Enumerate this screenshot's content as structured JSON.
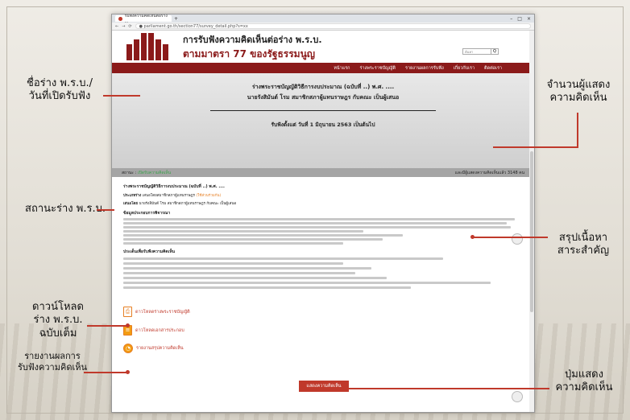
{
  "browser": {
    "tab_title": "รับฟังความคิดเห็นต่อร่าง ...",
    "url": "● parliament.go.th/section77/survey_detail.php?s=xx",
    "new_tab": "+",
    "win_controls": [
      "–",
      "□",
      "×"
    ]
  },
  "site": {
    "title_line1": "การรับฟังความคิดเห็นต่อร่าง พ.ร.บ.",
    "title_line2": "ตามมาตรา 77 ของรัฐธรรมนูญ",
    "search_placeholder": "ค้นหา",
    "search_button": "Q"
  },
  "nav": [
    "หน้าแรก",
    "ร่างพระราชบัญญัติ",
    "รายงานผลการรับฟัง",
    "เกี่ยวกับเรา",
    "ติดต่อเรา"
  ],
  "hero": {
    "line1": "ร่างพระราชบัญญัติวิธีการงบประมาณ (ฉบับที่ ..) พ.ศ. ....",
    "line2": "นายรังสิมันต์ โรม สมาชิกสภาผู้แทนราษฎร กับคณะ เป็นผู้เสนอ",
    "period": "รับฟังตั้งแต่ วันที่ 1 มิถุนายน 2563 เป็นต้นไป"
  },
  "status": {
    "label": "สถานะ :",
    "value": "เปิดรับความคิดเห็น",
    "count_text": "และมีผู้แสดงความคิดเห็นแล้ว 3148 คน"
  },
  "content": {
    "title": "ร่างพระราชบัญญัติวิธีการงบประมาณ (ฉบับที่ ..) พ.ศ. ....",
    "type_label": "ประเภทร่าง",
    "type_value": "เสนอโดยสมาชิกสภาผู้แทนราษฎร",
    "type_extra": "(ใช้ส่วนร่วมกัน)",
    "proposer_label": "เสนอโดย",
    "proposer_value": "นายรังสิมันต์ โรม สมาชิกสภาผู้แทนราษฎร กับคณะ เป็นผู้เสนอ",
    "section1": "ข้อมูลประกอบการพิจารณา",
    "section2": "ประเด็นเพื่อรับฟังความคิดเห็น"
  },
  "downloads": [
    {
      "icon": "pdf-icon",
      "label": "ดาวโหลดร่างพระราชบัญญัติ"
    },
    {
      "icon": "folder-icon",
      "label": "ดาวโหลดเอกสารประกอบ"
    },
    {
      "icon": "pie-chart-icon",
      "label": "รายงานสรุปความคิดเห็น"
    }
  ],
  "comment_button": "แสดงความคิดเห็น",
  "callouts": {
    "name": "ชื่อร่าง พ.ร.บ./\nวันที่เปิดรับฟัง",
    "count": "จำนวนผู้แสดง\nความคิดเห็น",
    "status": "สถานะร่าง พ.ร.บ.",
    "summary": "สรุปเนื้อหา\nสาระสำคัญ",
    "download": "ดาวน์โหลด\nร่าง พ.ร.บ.\nฉบับเต็ม",
    "report": "รายงานผลการ\nรับฟังความคิดเห็น",
    "button": "ปุ่มแสดง\nความคิดเห็น"
  },
  "colors": {
    "brand": "#8b1a1a",
    "callout_line": "#c0392b",
    "status_open": "#3aa34a",
    "accent": "#e67e22"
  }
}
